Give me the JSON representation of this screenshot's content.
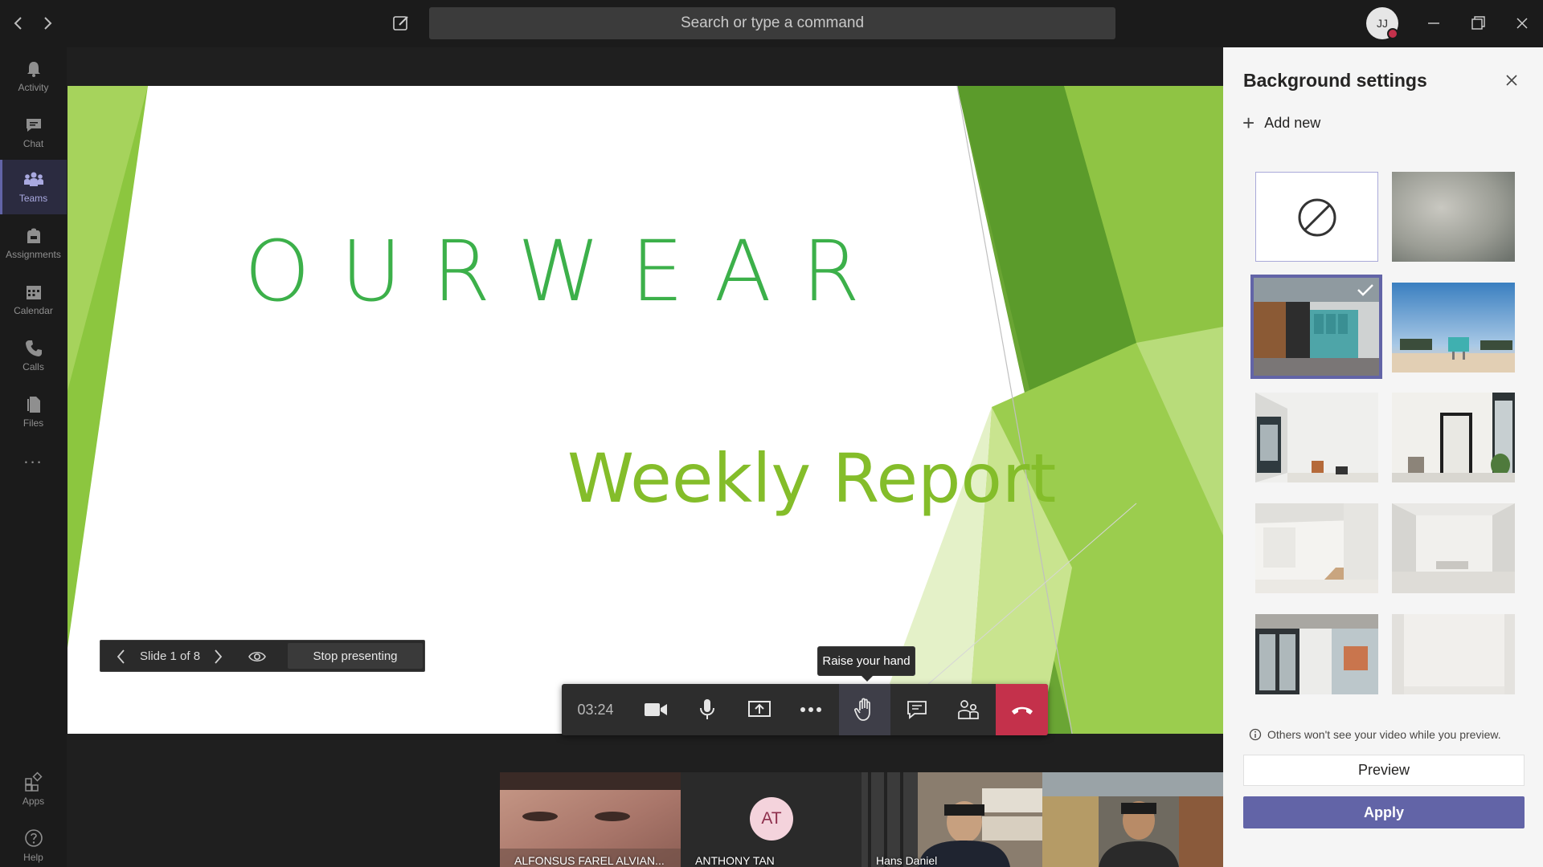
{
  "titlebar": {
    "search_placeholder": "Search or type a command",
    "avatar_initials": "JJ"
  },
  "rail": {
    "items": [
      {
        "label": "Activity",
        "icon": "bell-icon"
      },
      {
        "label": "Chat",
        "icon": "chat-icon"
      },
      {
        "label": "Teams",
        "icon": "teams-icon",
        "active": true
      },
      {
        "label": "Assignments",
        "icon": "backpack-icon"
      },
      {
        "label": "Calendar",
        "icon": "calendar-icon"
      },
      {
        "label": "Calls",
        "icon": "phone-icon"
      },
      {
        "label": "Files",
        "icon": "files-icon"
      }
    ],
    "more": "...",
    "bottom": [
      {
        "label": "Apps",
        "icon": "apps-icon"
      },
      {
        "label": "Help",
        "icon": "help-icon"
      }
    ]
  },
  "slide": {
    "logo": "OURWEAR",
    "subtitle": "Weekly Report",
    "colors": {
      "logo": "#3cb04a",
      "subtitle": "#84bd2a"
    }
  },
  "slidenav": {
    "counter": "Slide 1 of 8",
    "stop_label": "Stop presenting"
  },
  "tooltip": "Raise your hand",
  "callbar": {
    "timer": "03:24"
  },
  "participants": [
    {
      "name": "ALFONSUS FAREL ALVIAN...",
      "type": "video"
    },
    {
      "name": "ANTHONY TAN",
      "initials": "AT",
      "type": "avatar"
    },
    {
      "name": "Hans Daniel",
      "type": "video"
    },
    {
      "name": "",
      "type": "video"
    }
  ],
  "panel": {
    "title": "Background settings",
    "add_new": "Add new",
    "note": "Others won't see your video while you preview.",
    "preview_label": "Preview",
    "apply_label": "Apply",
    "accent": "#6264a7"
  }
}
